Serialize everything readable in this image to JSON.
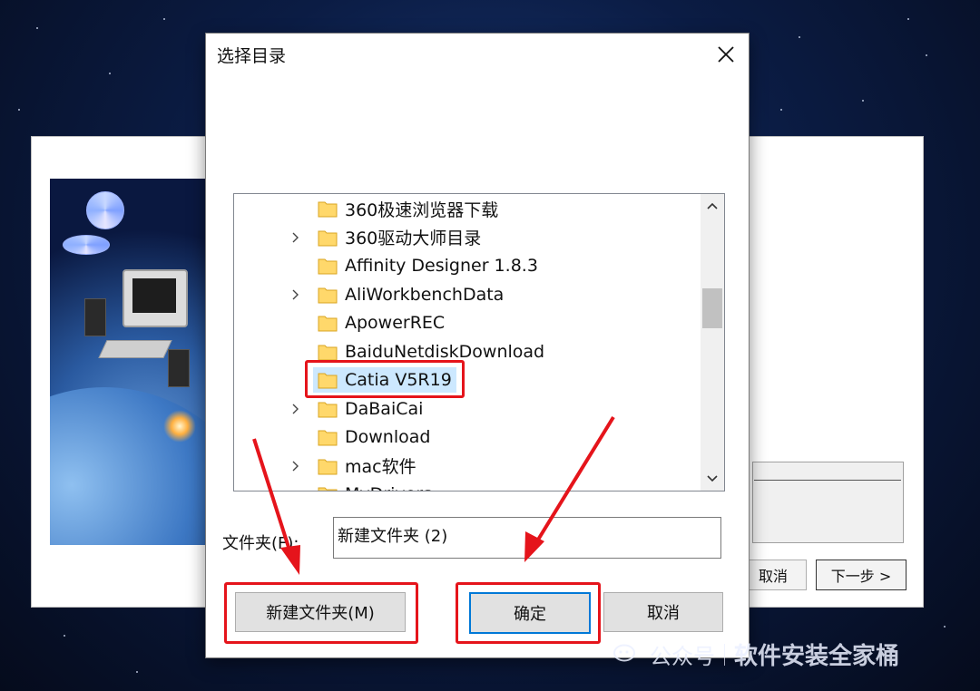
{
  "dialog": {
    "title": "选择目录",
    "tree_items": [
      {
        "label": "360极速浏览器下载",
        "has_children": false,
        "selected": false
      },
      {
        "label": "360驱动大师目录",
        "has_children": true,
        "selected": false
      },
      {
        "label": "Affinity Designer 1.8.3",
        "has_children": false,
        "selected": false
      },
      {
        "label": "AliWorkbenchData",
        "has_children": true,
        "selected": false
      },
      {
        "label": "ApowerREC",
        "has_children": false,
        "selected": false
      },
      {
        "label": "BaiduNetdiskDownload",
        "has_children": false,
        "selected": false
      },
      {
        "label": "Catia V5R19",
        "has_children": false,
        "selected": true
      },
      {
        "label": "DaBaiCai",
        "has_children": true,
        "selected": false
      },
      {
        "label": "Download",
        "has_children": false,
        "selected": false
      },
      {
        "label": "mac软件",
        "has_children": true,
        "selected": false
      },
      {
        "label": "MyDrivers",
        "has_children": false,
        "selected": false
      }
    ],
    "folder_label": "文件夹(F):",
    "folder_value": "新建文件夹 (2)",
    "buttons": {
      "new_folder": "新建文件夹(M)",
      "ok": "确定",
      "cancel": "取消"
    }
  },
  "installer": {
    "cancel_label": "取消",
    "next_label": "下一步 >"
  },
  "watermark": {
    "account_label": "公众号",
    "name": "软件安装全家桶"
  },
  "colors": {
    "highlight": "#e5141b",
    "selection": "#cce8ff",
    "folder": "#ffd86b",
    "primary_border": "#0078d7"
  }
}
